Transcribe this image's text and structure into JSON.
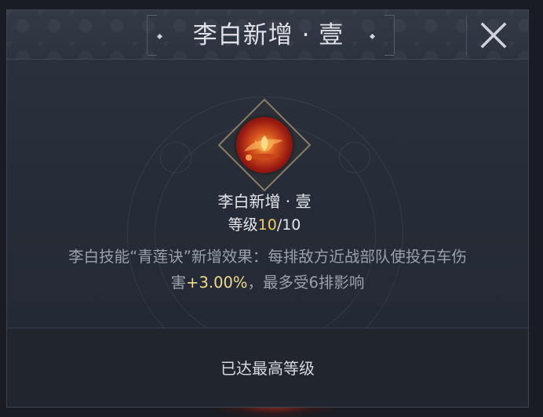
{
  "dialog": {
    "title": "李白新增 · 壹",
    "close_icon": "close-x-icon"
  },
  "skill": {
    "icon": "lotus-skill-icon",
    "name": "李白新增 · 壹",
    "level_prefix": "等级",
    "level_current": "10",
    "level_sep_max": "/10",
    "level_current_value": 10,
    "level_max_value": 10
  },
  "description": {
    "line1": "李白技能“青莲诀”新增效果：每排敌方近战部队使投石车伤",
    "line2_a": "害",
    "line2_highlight": "+3.00%",
    "line2_b": "，最多受6排影响"
  },
  "footer": {
    "status": "已达最高等级"
  },
  "colors": {
    "panel_bg": "#262c37",
    "title_text": "#dfe1e6",
    "level_highlight": "#f0cc66",
    "value_highlight": "#f0dc8e",
    "desc_text": "#9aa1ab"
  }
}
